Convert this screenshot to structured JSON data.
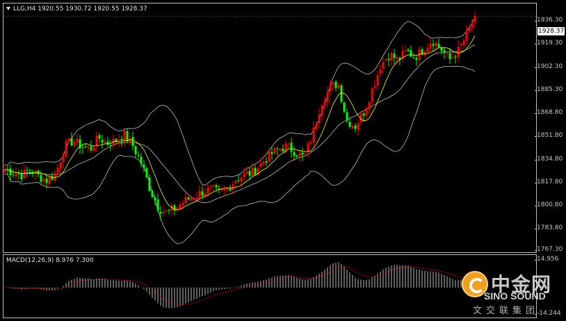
{
  "header": {
    "symbol_info": "LLG,H4  1920.55 1930.72 1920.55 1928.37"
  },
  "price_axis": {
    "ticks": [
      "1936.30",
      "1919.30",
      "1902.30",
      "1885.30",
      "1868.80",
      "1851.80",
      "1834.80",
      "1817.80",
      "1800.80",
      "1783.80",
      "1767.30"
    ],
    "current_price": "1928.37"
  },
  "macd": {
    "label": "MACD(12,26,9) 8.976 7.300",
    "ticks": [
      "14.956",
      "-14.244"
    ]
  },
  "watermark": {
    "cn": "中金网",
    "en": "SINO SOUND",
    "sub": "文交联集团"
  },
  "colors": {
    "up_candle": "#ff0000",
    "down_candle": "#00ff00",
    "ma_fast": "#ffff00",
    "bands": "#c0c0c0",
    "macd_hist": "#c0c0c0",
    "macd_signal": "#ff0000"
  },
  "chart_data": {
    "type": "candlestick",
    "symbol": "LLG",
    "timeframe": "H4",
    "ylim": [
      1767.3,
      1936.3
    ],
    "close_path": [
      1822,
      1820,
      1818,
      1822,
      1817,
      1814,
      1820,
      1838,
      1842,
      1838,
      1836,
      1844,
      1840,
      1842,
      1846,
      1838,
      1826,
      1808,
      1795,
      1792,
      1795,
      1800,
      1803,
      1806,
      1808,
      1806,
      1808,
      1815,
      1818,
      1820,
      1826,
      1832,
      1836,
      1838,
      1834,
      1830,
      1846,
      1868,
      1878,
      1882,
      1856,
      1852,
      1862,
      1878,
      1895,
      1902,
      1898,
      1904,
      1900,
      1906,
      1912,
      1906,
      1898,
      1904,
      1915,
      1928
    ],
    "macd_range": [
      -14.244,
      14.956
    ],
    "macd_value": 8.976,
    "signal_value": 7.3
  }
}
